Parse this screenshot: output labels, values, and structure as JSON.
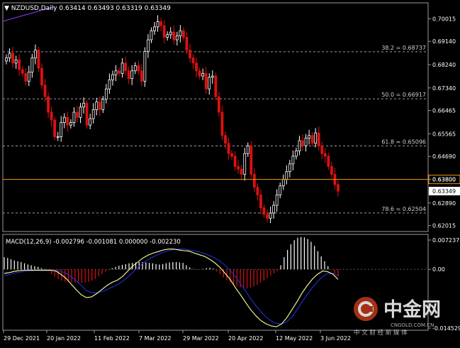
{
  "main": {
    "symbol_header": "NZDUSD,Daily",
    "ohlc": "0.63414 0.63493 0.63319 0.63349",
    "price_ticks": [
      "0.70015",
      "0.69140",
      "0.68240",
      "0.67340",
      "0.66465",
      "0.65565",
      "0.64690",
      "0.63800",
      "0.62890",
      "0.62015"
    ],
    "fib_levels": [
      {
        "label": "38.2 = 0.68737",
        "price": 0.68737
      },
      {
        "label": "50.0 = 0.66917",
        "price": 0.66917
      },
      {
        "label": "61.8 = 0.65096",
        "price": 0.65096
      },
      {
        "label": "78.6 = 0.62504",
        "price": 0.62504
      }
    ],
    "h_line": {
      "label": "0.63800",
      "price": 0.638,
      "color": "#ff9900"
    },
    "current_price": {
      "label": "0.63349",
      "price": 0.63349
    }
  },
  "macd": {
    "header": "MACD(12,26,9) -0.002796 -0.001081 0.000000 -0.002230",
    "ticks": [
      "0.007237",
      "0.00",
      "-0.014529"
    ]
  },
  "x_axis": {
    "labels": [
      "29 Dec 2021",
      "20 Jan 2022",
      "11 Feb 2022",
      "7 Mar 2022",
      "29 Mar 2022",
      "20 Apr 2022",
      "12 May 2022",
      "3 Jun 2022"
    ]
  },
  "watermark": {
    "brand": "中金网",
    "url": "CNGOLD.COM.CN",
    "tagline": "中 文 财 经 新 媒 体"
  },
  "colors": {
    "up": "#ffffff",
    "down": "#dd1111",
    "grid": "#9a9a9a",
    "macd_line": "#ffff99",
    "signal_line": "#1f2fd8",
    "hline": "#ff9900"
  },
  "chart_data": {
    "type": "candlestick",
    "price_range": [
      0.6184,
      0.7052
    ],
    "closes": [
      0.685,
      0.6868,
      0.683,
      0.6842,
      0.6805,
      0.679,
      0.676,
      0.6795,
      0.685,
      0.688,
      0.681,
      0.6745,
      0.67,
      0.664,
      0.661,
      0.6545,
      0.6545,
      0.66,
      0.662,
      0.659,
      0.66,
      0.664,
      0.662,
      0.666,
      0.6675,
      0.659,
      0.6615,
      0.665,
      0.668,
      0.665,
      0.669,
      0.673,
      0.6765,
      0.6785,
      0.68,
      0.679,
      0.683,
      0.68,
      0.677,
      0.68,
      0.682,
      0.68,
      0.676,
      0.6875,
      0.692,
      0.6955,
      0.697,
      0.699,
      0.6975,
      0.693,
      0.694,
      0.695,
      0.692,
      0.6935,
      0.6955,
      0.693,
      0.688,
      0.685,
      0.683,
      0.68,
      0.678,
      0.679,
      0.673,
      0.6775,
      0.678,
      0.67,
      0.664,
      0.655,
      0.652,
      0.648,
      0.647,
      0.643,
      0.642,
      0.64,
      0.648,
      0.651,
      0.64,
      0.635,
      0.632,
      0.627,
      0.6245,
      0.623,
      0.625,
      0.628,
      0.632,
      0.6355,
      0.638,
      0.641,
      0.644,
      0.647,
      0.649,
      0.653,
      0.651,
      0.654,
      0.655,
      0.652,
      0.656,
      0.651,
      0.648,
      0.647,
      0.643,
      0.64,
      0.636,
      0.6335
    ],
    "macd_range": [
      -0.014529,
      0.007237
    ],
    "macd_line": [
      -0.001,
      -0.0008,
      -0.0005,
      -0.0003,
      -0.0002,
      -0.0002,
      -0.0002,
      -0.0002,
      -0.0002,
      -0.0002,
      -0.0004,
      -0.0012,
      -0.0022,
      -0.0036,
      -0.005,
      -0.0063,
      -0.007,
      -0.0068,
      -0.006,
      -0.005,
      -0.004,
      -0.0032,
      -0.0027,
      -0.0018,
      -0.0005,
      0.0008,
      0.0018,
      0.0028,
      0.0035,
      0.004,
      0.0044,
      0.0048,
      0.005,
      0.005,
      0.0048,
      0.0046,
      0.0045,
      0.004,
      0.0036,
      0.0032,
      0.0025,
      0.0016,
      0.0005,
      -0.001,
      -0.0025,
      -0.0045,
      -0.0063,
      -0.0082,
      -0.01,
      -0.0115,
      -0.0127,
      -0.0135,
      -0.014,
      -0.0142,
      -0.0135,
      -0.012,
      -0.01,
      -0.008,
      -0.0058,
      -0.004,
      -0.0024,
      -0.0012,
      -0.0004,
      -0.0006,
      -0.0012,
      -0.0025
    ],
    "signal_line": [
      -0.0015,
      -0.0013,
      -0.001,
      -0.0007,
      -0.0005,
      -0.0004,
      -0.0003,
      -0.0003,
      -0.0003,
      -0.0003,
      -0.0003,
      -0.0005,
      -0.001,
      -0.0018,
      -0.0028,
      -0.004,
      -0.0052,
      -0.0058,
      -0.0058,
      -0.0055,
      -0.005,
      -0.0044,
      -0.0038,
      -0.003,
      -0.002,
      -0.0008,
      0.0005,
      0.0015,
      0.0024,
      0.0031,
      0.0037,
      0.0042,
      0.0046,
      0.0049,
      0.005,
      0.005,
      0.0048,
      0.0046,
      0.0043,
      0.0039,
      0.0034,
      0.0028,
      0.002,
      0.001,
      -0.0003,
      -0.0018,
      -0.0035,
      -0.0054,
      -0.0073,
      -0.009,
      -0.0105,
      -0.0118,
      -0.0128,
      -0.0134,
      -0.0135,
      -0.013,
      -0.0118,
      -0.01,
      -0.008,
      -0.0062,
      -0.0045,
      -0.003,
      -0.0018,
      -0.001,
      -0.001,
      -0.0016
    ],
    "histogram": [
      0.003,
      0.0028,
      0.0025,
      0.0022,
      0.002,
      0.0018,
      0.0015,
      0.0012,
      0.001,
      0.0008,
      0.0006,
      0.0003,
      0.0001,
      -0.0005,
      -0.0012,
      -0.0018,
      -0.0024,
      -0.0028,
      -0.003,
      -0.0031,
      -0.0032,
      -0.0033,
      -0.0034,
      -0.0034,
      -0.0033,
      -0.0031,
      -0.0028,
      -0.0024,
      -0.0018,
      -0.0012,
      -0.0006,
      -0.0002,
      0.0003,
      0.0006,
      0.0009,
      0.0011,
      0.0013,
      0.0015,
      0.0016,
      0.0017,
      0.0018,
      0.0018,
      0.0017,
      0.0016,
      0.0015,
      0.0013,
      0.0012,
      0.0013,
      0.0015,
      0.0017,
      0.0018,
      0.0018,
      0.0017,
      0.0016,
      0.001,
      0.0005,
      0.0001,
      -0.0002,
      -0.0001,
      0.0001,
      0.0003,
      0.0004,
      0.0002,
      -0.0005,
      -0.0012,
      -0.002,
      -0.0027,
      -0.0033,
      -0.0038,
      -0.0042,
      -0.0045,
      -0.0047,
      -0.0047,
      -0.0045,
      -0.0042,
      -0.0038,
      -0.0033,
      -0.0028,
      -0.0022,
      -0.0016,
      -0.001,
      -0.0005,
      0.001,
      0.003,
      0.0048,
      0.0062,
      0.0072,
      0.0078,
      0.008,
      0.0079,
      0.0075,
      0.0068,
      0.0058,
      0.0045,
      0.0032,
      0.002,
      0.0008,
      -0.0002,
      -0.001,
      -0.0018
    ]
  }
}
